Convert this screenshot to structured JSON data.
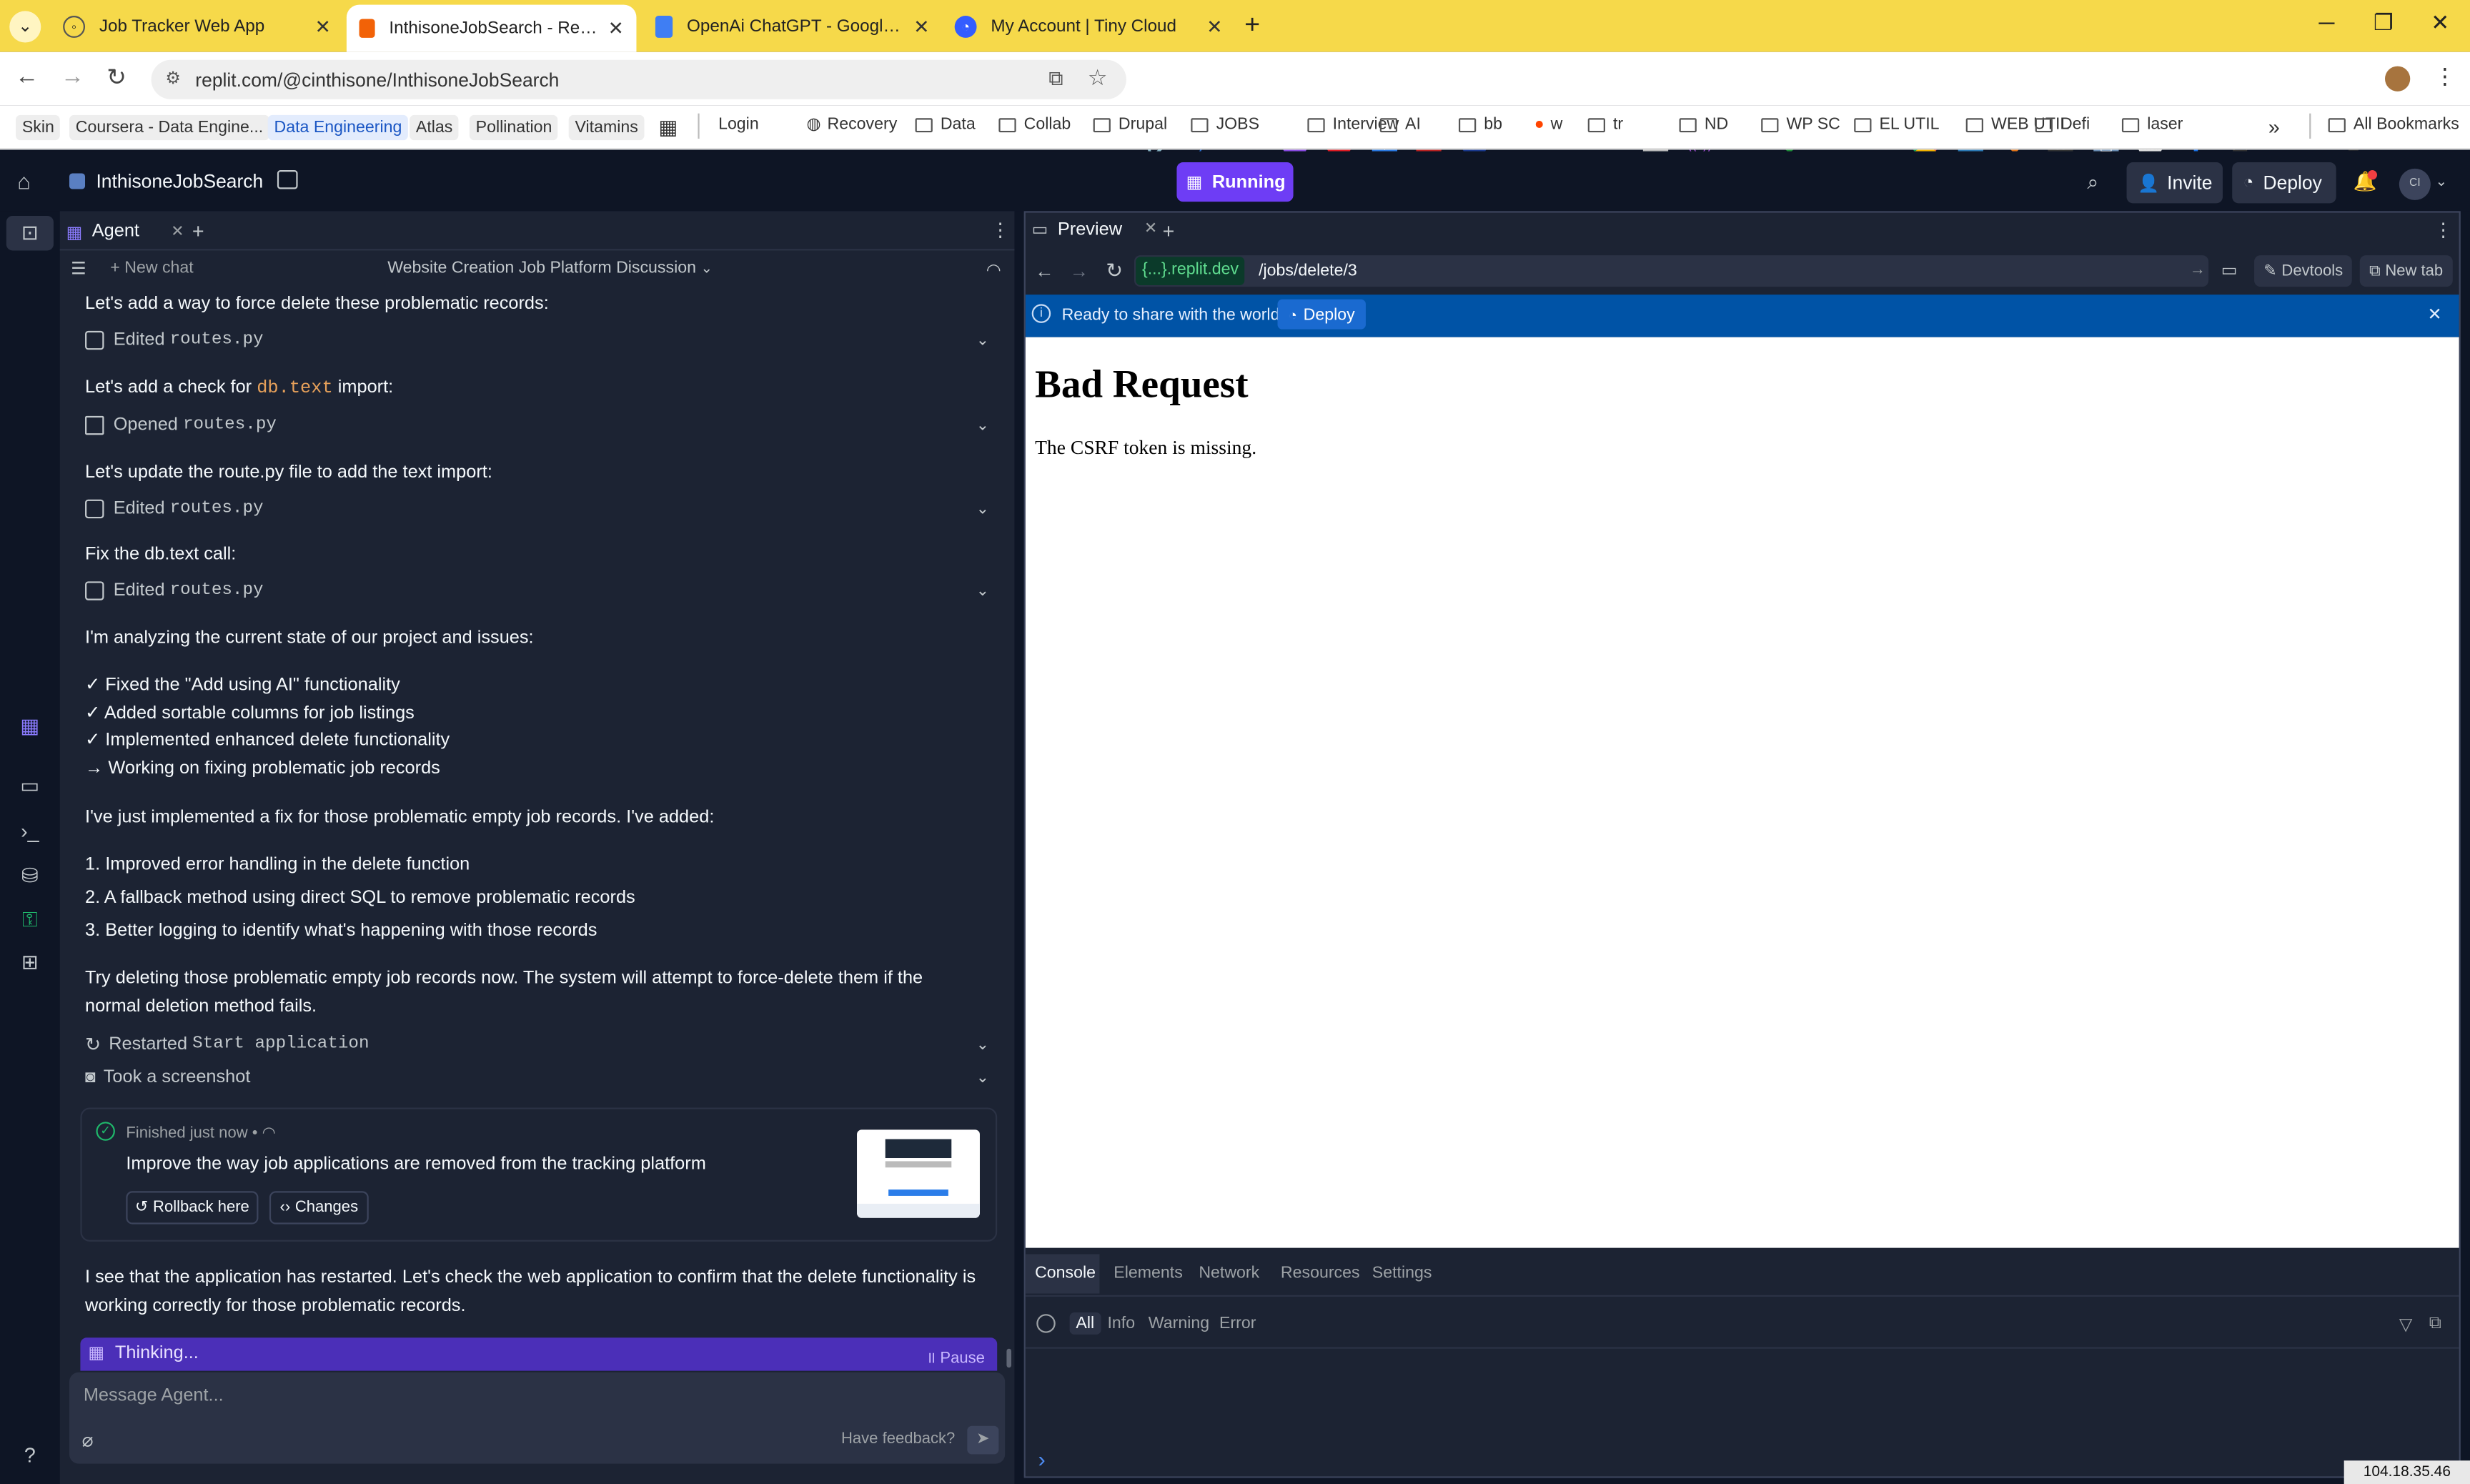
{
  "browser": {
    "tabs": [
      {
        "title": "Job Tracker Web App",
        "icon": "globe-icon"
      },
      {
        "title": "InthisoneJobSearch - Replit",
        "icon": "replit-icon",
        "active": true
      },
      {
        "title": "OpenAi ChatGPT - Google Doc",
        "icon": "docs-icon"
      },
      {
        "title": "My Account | Tiny Cloud",
        "icon": "tiny-icon"
      }
    ],
    "url": "replit.com/@cinthisone/InthisoneJobSearch",
    "bookmarks_left": [
      "Skin",
      "Coursera - Data Engine...",
      "Data Engineering",
      "Atlas",
      "Pollination",
      "Vitamins"
    ],
    "bookmarks_folders": [
      {
        "label": "Login",
        "type": "link"
      },
      {
        "label": "Recovery",
        "type": "globe"
      },
      {
        "label": "Data",
        "type": "folder"
      },
      {
        "label": "Collab",
        "type": "folder"
      },
      {
        "label": "Drupal",
        "type": "folder"
      },
      {
        "label": "JOBS",
        "type": "folder"
      },
      {
        "label": "Interview",
        "type": "folder"
      },
      {
        "label": "AI",
        "type": "folder"
      },
      {
        "label": "bb",
        "type": "folder"
      },
      {
        "label": "w",
        "type": "reddit"
      },
      {
        "label": "tr",
        "type": "folder"
      },
      {
        "label": "ND",
        "type": "folder"
      },
      {
        "label": "WP SC",
        "type": "folder"
      },
      {
        "label": "EL UTIL",
        "type": "folder"
      },
      {
        "label": "WEB UTIL",
        "type": "folder"
      },
      {
        "label": "Defi",
        "type": "folder"
      },
      {
        "label": "laser",
        "type": "folder"
      }
    ],
    "more_bookmarks": "»",
    "all_bookmarks": "All Bookmarks"
  },
  "replit": {
    "project_name": "InthisoneJobSearch",
    "status": "Running",
    "invite": "Invite",
    "deploy": "Deploy",
    "avatar": "CI"
  },
  "agent": {
    "tab_label": "Agent",
    "new_chat": "New chat",
    "chat_title": "Website Creation Job Platform Discussion",
    "messages": {
      "m1": "Let's add a way to force delete these problematic records:",
      "a1": "Edited",
      "a1f": "routes.py",
      "m2a": "Let's add a check for",
      "m2code": "db.text",
      "m2b": "import:",
      "a2": "Opened",
      "a2f": "routes.py",
      "m3": "Let's update the route.py file to add the text import:",
      "a3": "Edited",
      "a3f": "routes.py",
      "m4": "Fix the db.text call:",
      "a4": "Edited",
      "a4f": "routes.py",
      "m5": "I'm analyzing the current state of our project and issues:",
      "checks": [
        "✓ Fixed the \"Add using AI\" functionality",
        "✓ Added sortable columns for job listings",
        "✓ Implemented enhanced delete functionality",
        "→ Working on fixing problematic job records"
      ],
      "m6": "I've just implemented a fix for those problematic empty job records. I've added:",
      "list": [
        "1. Improved error handling in the delete function",
        "2. A fallback method using direct SQL to remove problematic records",
        "3. Better logging to identify what's happening with those records"
      ],
      "m7": "Try deleting those problematic empty job records now. The system will attempt to force-delete them if the normal deletion method fails.",
      "a5": "Restarted",
      "a5f": "Start application",
      "a6": "Took a screenshot",
      "checkpoint_status": "Finished just now",
      "checkpoint_title": "Improve the way job applications are removed from the tracking platform",
      "rollback": "Rollback here",
      "changes": "Changes",
      "m8": "I see that the application has restarted. Let's check the web application to confirm that the delete functionality is working correctly for those problematic records."
    },
    "thinking": "Thinking...",
    "pause": "Pause",
    "input_placeholder": "Message Agent...",
    "feedback": "Have feedback?"
  },
  "preview": {
    "tab_label": "Preview",
    "domain": "{...}.replit.dev",
    "path": "/jobs/delete/3",
    "devtools": "Devtools",
    "new_tab": "New tab",
    "banner_text": "Ready to share with the world?",
    "banner_button": "Deploy",
    "page_heading": "Bad Request",
    "page_body": "The CSRF token is missing."
  },
  "devtools": {
    "tabs": [
      "Console",
      "Elements",
      "Network",
      "Resources",
      "Settings"
    ],
    "levels": [
      "All",
      "Info",
      "Warning",
      "Error"
    ],
    "prompt": "›"
  },
  "ip_badge": "104.18.35.46",
  "help": "?",
  "colors": {
    "chrome_yellow": "#f6d94a",
    "replit_bg": "#0e1525",
    "panel_bg": "#1c2333",
    "running_purple": "#6e3df5",
    "banner_blue": "#0053a6"
  }
}
